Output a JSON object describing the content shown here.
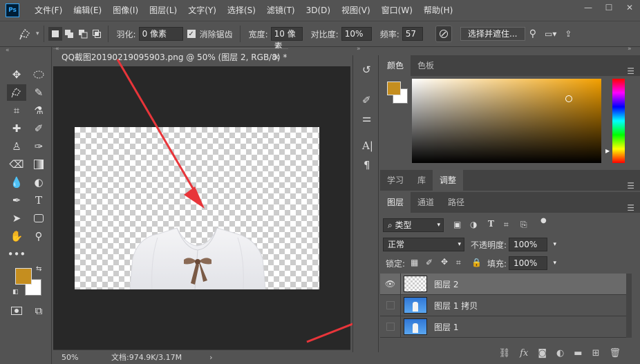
{
  "menubar": {
    "logo": "Ps",
    "items": [
      "文件(F)",
      "编辑(E)",
      "图像(I)",
      "图层(L)",
      "文字(Y)",
      "选择(S)",
      "滤镜(T)",
      "3D(D)",
      "视图(V)",
      "窗口(W)",
      "帮助(H)"
    ],
    "win_min": "—",
    "win_max": "☐",
    "win_close": "✕"
  },
  "options": {
    "feather_label": "羽化:",
    "feather_value": "0 像素",
    "antialias_label": "消除锯齿",
    "width_label": "宽度:",
    "width_value": "10 像素",
    "contrast_label": "对比度:",
    "contrast_value": "10%",
    "freq_label": "频率:",
    "freq_value": "57",
    "select_mask": "选择并遮住..."
  },
  "document": {
    "tab_title": "QQ截图20190219095903.png @ 50% (图层 2, RGB/8) *",
    "zoom": "50%",
    "doc_info": "文档:974.9K/3.17M"
  },
  "colors": {
    "foreground": "#c58e1f",
    "background": "#ffffff"
  },
  "panels": {
    "color_tabs": [
      "颜色",
      "色板"
    ],
    "learn_tabs": [
      "学习",
      "库",
      "调整"
    ],
    "layer_tabs": [
      "图层",
      "通道",
      "路径"
    ],
    "filter_kind": "类型",
    "blend_mode": "正常",
    "opacity_label": "不透明度:",
    "opacity_value": "100%",
    "lock_label": "锁定:",
    "fill_label": "填充:",
    "fill_value": "100%"
  },
  "layers": [
    {
      "name": "图层 2",
      "visible": true,
      "selected": true
    },
    {
      "name": "图层 1 拷贝",
      "visible": false,
      "selected": false
    },
    {
      "name": "图层 1",
      "visible": false,
      "selected": false
    }
  ]
}
